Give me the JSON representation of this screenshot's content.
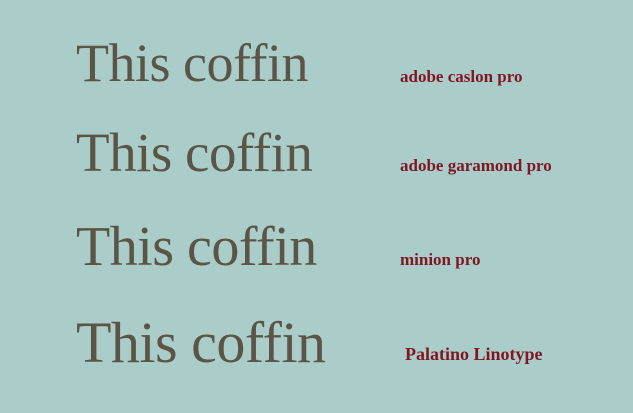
{
  "colors": {
    "background": "#abcdca",
    "sample_text": "#5b5547",
    "font_label": "#7e1624"
  },
  "rows": [
    {
      "sample": "This coffin",
      "label": "adobe caslon pro"
    },
    {
      "sample": "This coffin",
      "label": "adobe garamond pro"
    },
    {
      "sample": "This coffin",
      "label": "minion pro"
    },
    {
      "sample": "This coffin",
      "label": "Palatino Linotype"
    }
  ]
}
